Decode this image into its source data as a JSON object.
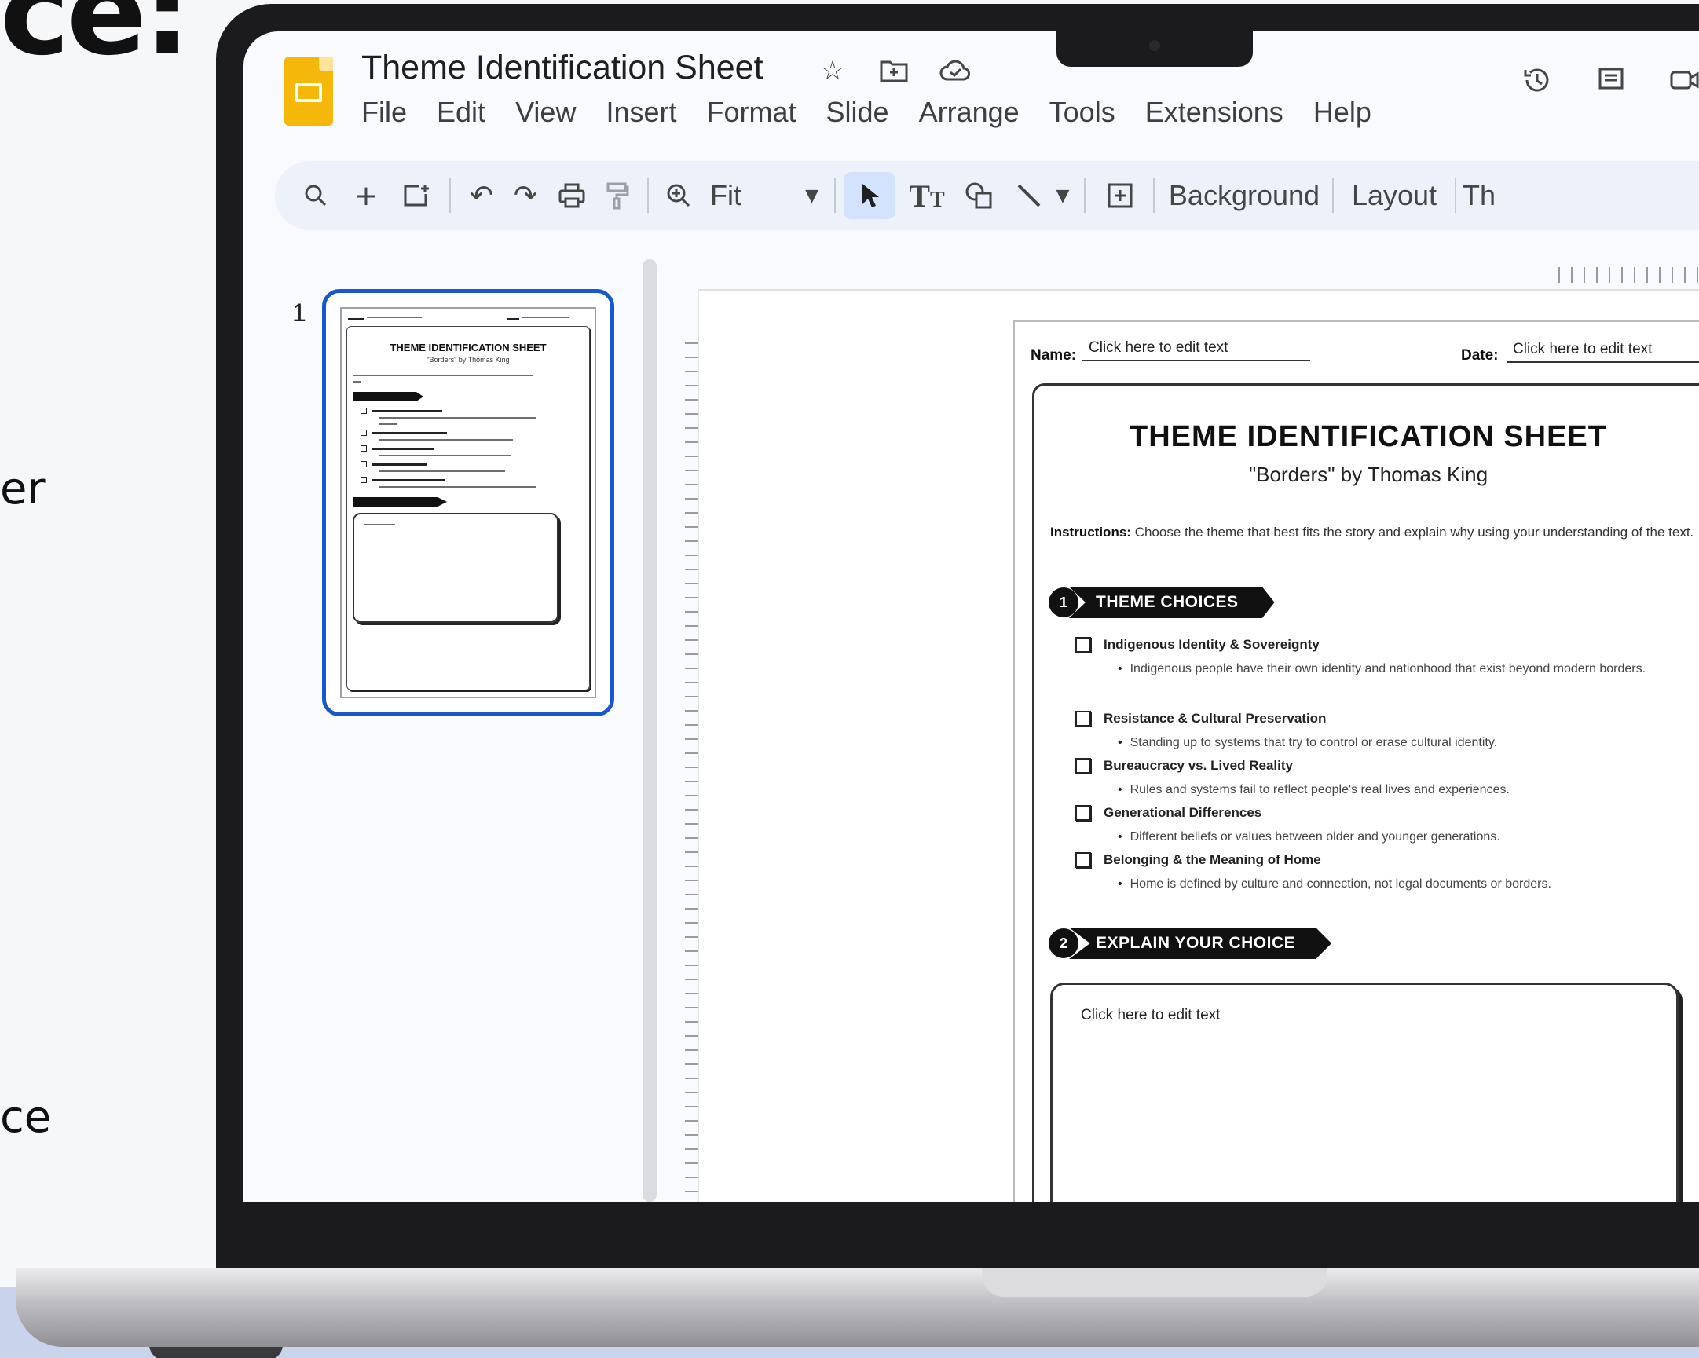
{
  "background": {
    "heading_fragment": "ce:",
    "text_fragment_1": "er",
    "text_fragment_2": "ce"
  },
  "app": {
    "doc_title": "Theme Identification Sheet",
    "title_icons": [
      "star-icon",
      "move-to-folder-icon",
      "cloud-saved-icon"
    ],
    "menu": [
      "File",
      "Edit",
      "View",
      "Insert",
      "Format",
      "Slide",
      "Arrange",
      "Tools",
      "Extensions",
      "Help"
    ],
    "top_right_icons": [
      "version-history-icon",
      "comments-icon",
      "camera-icon"
    ]
  },
  "toolbar": {
    "zoom_label": "Fit",
    "background_label": "Background",
    "layout_label": "Layout",
    "theme_label_truncated": "Th"
  },
  "filmstrip": {
    "slide_number": "1",
    "thumb_title": "THEME IDENTIFICATION SHEET",
    "thumb_subtitle": "\"Borders\" by Thomas King"
  },
  "document": {
    "name_label": "Name:",
    "name_value": "Click here to edit text",
    "date_label": "Date:",
    "date_value": "Click here to edit text",
    "title": "THEME IDENTIFICATION SHEET",
    "subtitle": "\"Borders\" by Thomas King",
    "instructions_label": "Instructions:",
    "instructions_text": "Choose the theme that best fits the story and explain why using your understanding of the text.",
    "section1_num": "1",
    "section1_title": "THEME CHOICES",
    "choices": [
      {
        "label": "Indigenous Identity & Sovereignty",
        "desc": "Indigenous people have their own identity and nationhood that exist beyond modern borders."
      },
      {
        "label": "Resistance & Cultural Preservation",
        "desc": "Standing up to systems that try to control or erase cultural identity."
      },
      {
        "label": "Bureaucracy vs. Lived Reality",
        "desc": "Rules and systems fail to reflect people's real lives and experiences."
      },
      {
        "label": "Generational Differences",
        "desc": "Different beliefs or values between older and younger generations."
      },
      {
        "label": "Belonging & the Meaning of Home",
        "desc": "Home is defined by culture and connection, not legal documents or borders."
      }
    ],
    "section2_num": "2",
    "section2_title": "EXPLAIN YOUR CHOICE",
    "answer_placeholder": "Click here to edit text"
  }
}
